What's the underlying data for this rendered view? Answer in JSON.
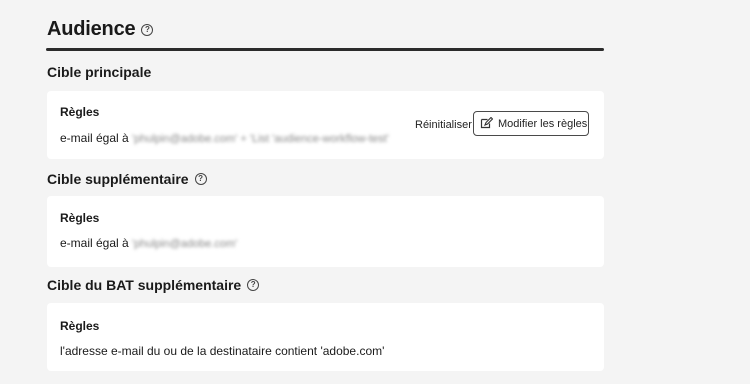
{
  "header": {
    "title": "Audience"
  },
  "sections": [
    {
      "title": "Cible principale",
      "rules_label": "Règles",
      "rule_prefix": "e-mail égal à",
      "rule_value": "'phulpin@adobe.com' + 'List 'audience-workflow-test'",
      "reset_label": "Réinitialiser",
      "edit_label": "Modifier les règles"
    },
    {
      "title": "Cible supplémentaire",
      "rules_label": "Règles",
      "rule_prefix": "e-mail égal à",
      "rule_value": "'phulpin@adobe.com'"
    },
    {
      "title": "Cible du BAT supplémentaire",
      "rules_label": "Règles",
      "rule_prefix": "l'adresse e-mail du ou de la destinataire contient 'adobe.com'"
    }
  ]
}
